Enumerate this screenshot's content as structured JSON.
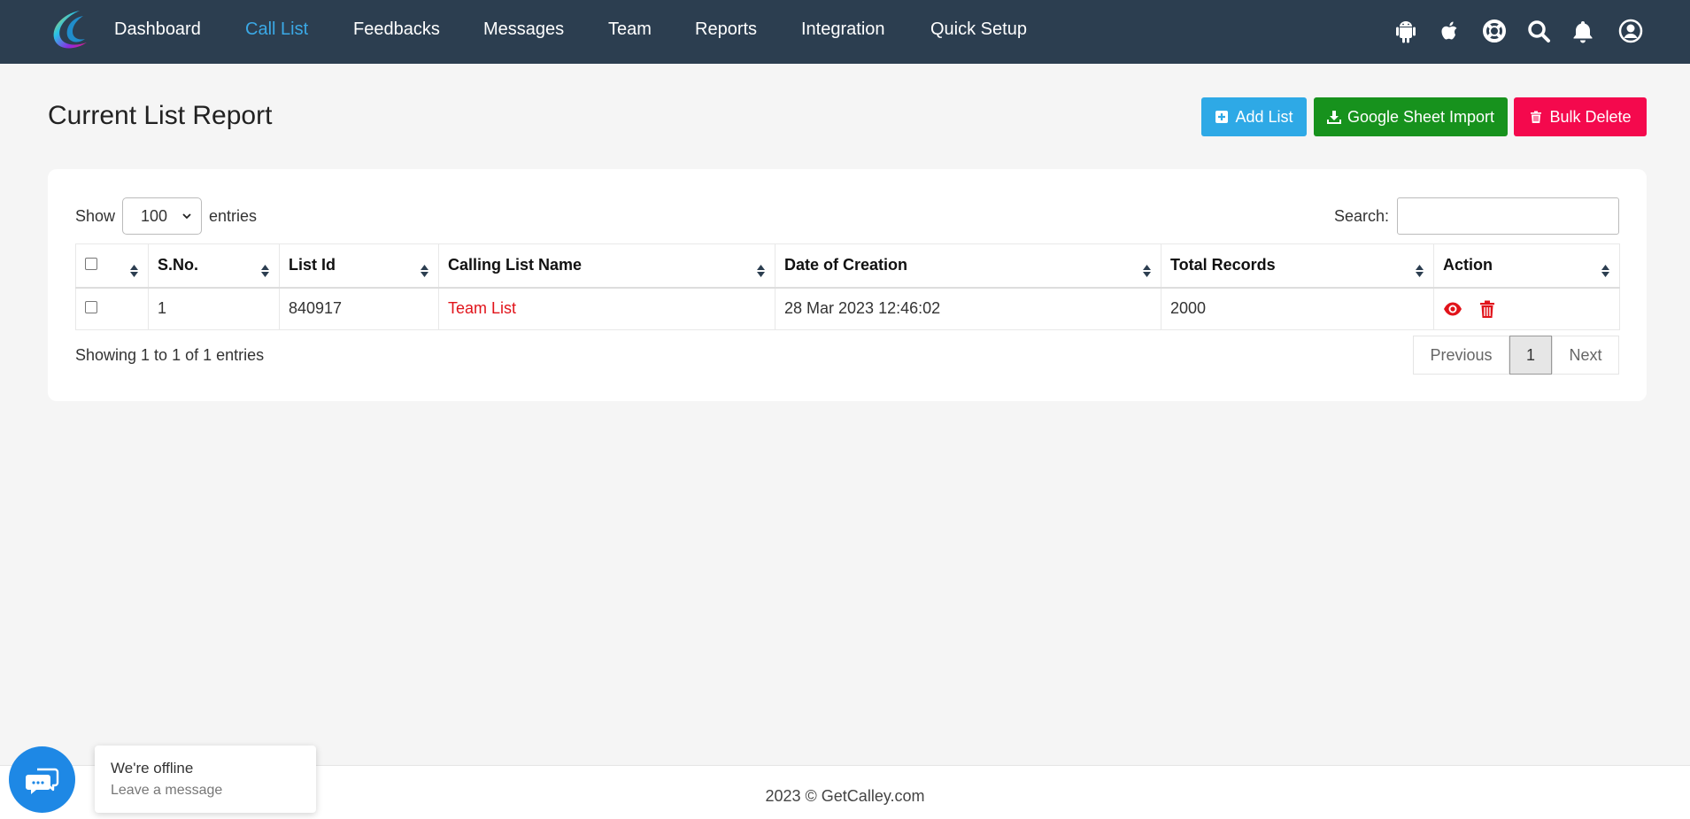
{
  "nav": {
    "items": [
      {
        "label": "Dashboard",
        "active": false
      },
      {
        "label": "Call List",
        "active": true
      },
      {
        "label": "Feedbacks",
        "active": false
      },
      {
        "label": "Messages",
        "active": false
      },
      {
        "label": "Team",
        "active": false
      },
      {
        "label": "Reports",
        "active": false
      },
      {
        "label": "Integration",
        "active": false
      },
      {
        "label": "Quick Setup",
        "active": false
      }
    ],
    "icons": [
      "android-icon",
      "apple-icon",
      "lifebuoy-icon",
      "search-icon",
      "bell-icon",
      "user-circle-icon"
    ]
  },
  "page": {
    "title": "Current List Report",
    "buttons": {
      "add_list": "Add List",
      "google_sheet_import": "Google Sheet Import",
      "bulk_delete": "Bulk Delete"
    }
  },
  "table_controls": {
    "show_label": "Show",
    "entries_value": "100",
    "entries_label": "entries",
    "search_label": "Search:",
    "search_value": ""
  },
  "table": {
    "headers": [
      "S.No.",
      "List Id",
      "Calling List Name",
      "Date of Creation",
      "Total Records",
      "Action"
    ],
    "rows": [
      {
        "sno": "1",
        "list_id": "840917",
        "name": "Team List",
        "date": "28 Mar 2023 12:46:02",
        "total": "2000"
      }
    ]
  },
  "pagination": {
    "info": "Showing 1 to 1 of 1 entries",
    "previous": "Previous",
    "page": "1",
    "next": "Next"
  },
  "footer": {
    "text": "2023 © GetCalley.com"
  },
  "chat": {
    "title": "We're offline",
    "subtitle": "Leave a message"
  },
  "colors": {
    "nav_bg": "#2c3e50",
    "active_nav": "#3ba9e6",
    "add_list": "#2ea9e6",
    "import": "#17921d",
    "bulk_delete": "#f4094d",
    "link_red": "#e1131a",
    "chat_blue": "#1e88e5"
  }
}
